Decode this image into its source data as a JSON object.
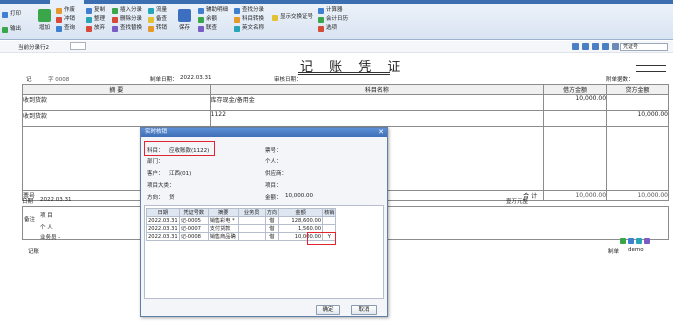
{
  "ribbon": {
    "active_tab": "",
    "print": "打印",
    "export": "输出",
    "add": "增加",
    "col1": [
      "作废",
      "冲销",
      "查询"
    ],
    "col2": [
      "复制",
      "整理",
      "放弃"
    ],
    "col3": [
      "插入分录",
      "删除分录",
      "查找替换"
    ],
    "col4": [
      "流量",
      "备查",
      "转销"
    ],
    "save": "保存",
    "col5": [
      "辅助明细",
      "余额",
      "联查"
    ],
    "col6": [
      "查找分录",
      "科目转换",
      "英文名称"
    ],
    "show_voucher": "显示交换证号",
    "col7": [
      "计算器",
      "会计日历",
      "选项"
    ]
  },
  "toolbar2": {
    "current_entry": "当前分录行2",
    "search_value": "凭证号"
  },
  "voucher": {
    "title": "记 账 凭 证",
    "prefix": "记",
    "number_label": "字 0008",
    "date_label": "制单日期：",
    "date": "2022.03.31",
    "audit_label": "审核日期：",
    "attach_label": "附单据数：",
    "col_summary": "摘 要",
    "col_account": "科目名称",
    "col_debit": "借方金额",
    "col_credit": "贷方金额",
    "rows": [
      {
        "summary": "收到货款",
        "account": "库存现金/备用金",
        "debit": "10,000.00",
        "credit": ""
      },
      {
        "summary": "收到货款",
        "account": "1122",
        "debit": "",
        "credit": "10,000.00"
      }
    ],
    "bill_label": "票号",
    "date2_label": "日期",
    "date2": "2022.03.31",
    "total_label": "合 计",
    "total_debit": "10,000.00",
    "total_credit": "10,000.00",
    "amount_words": "壹万元整",
    "note_label": "备注",
    "note_project": "项 目",
    "note_person": "个 人",
    "note_business": "业务员 -",
    "bookkeeper": "记账",
    "maker": "制单",
    "maker_name": "demo"
  },
  "dialog": {
    "title": "实时核销",
    "subject_label": "科目：",
    "subject_value": "应收账款(1122)",
    "bill_no": "票号：",
    "department": "部门：",
    "person": "个人：",
    "customer": "客户：",
    "customer_value": "江西(01)",
    "supplier": "供应商：",
    "project_class": "项目大类：",
    "project": "项目：",
    "direction": "方向：",
    "direction_value": "贷",
    "amount": "金额：",
    "amount_value": "10,000.00",
    "headers": [
      "日期",
      "凭证号数",
      "摘要",
      "业务员",
      "方向",
      "金额",
      "核销"
    ],
    "rows": [
      {
        "date": "2022.03.31",
        "voucher": "记-0005",
        "summary": "销售彩电 *",
        "clerk": "",
        "dir": "借",
        "amount": "128,600.00",
        "mark": ""
      },
      {
        "date": "2022.03.31",
        "voucher": "记-0007",
        "summary": "支付货款",
        "clerk": "",
        "dir": "借",
        "amount": "1,560.00",
        "mark": ""
      },
      {
        "date": "2022.03.31",
        "voucher": "记-0008",
        "summary": "销售商品确",
        "clerk": "",
        "dir": "借",
        "amount": "10,000.00",
        "mark": "Y"
      }
    ],
    "ok": "确定",
    "cancel": "取消"
  }
}
